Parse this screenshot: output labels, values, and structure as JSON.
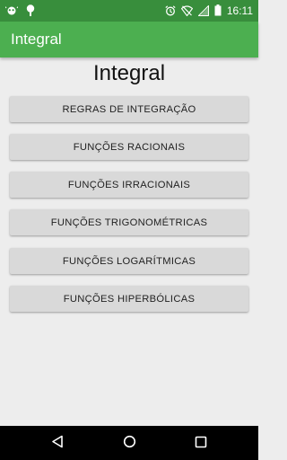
{
  "status_bar": {
    "time": "16:11",
    "left_icons": [
      "notification-icon",
      "android-icon"
    ],
    "right_icons": [
      "alarm-icon",
      "wifi-off-icon",
      "signal-icon",
      "battery-icon"
    ]
  },
  "app_bar": {
    "title": "Integral"
  },
  "main": {
    "heading": "Integral",
    "buttons": [
      "REGRAS DE INTEGRAÇÃO",
      "FUNÇÕES RACIONAIS",
      "FUNÇÕES IRRACIONAIS",
      "FUNÇÕES TRIGONOMÉTRICAS",
      "FUNÇÕES LOGARÍTMICAS",
      "FUNÇÕES HIPERBÓLICAS"
    ]
  },
  "nav_bar": {
    "icons": [
      "back-icon",
      "home-icon",
      "recents-icon"
    ]
  },
  "colors": {
    "status_bar": "#388e3c",
    "app_bar": "#4caf50",
    "background": "#ededed",
    "button": "#d9d9d9"
  }
}
